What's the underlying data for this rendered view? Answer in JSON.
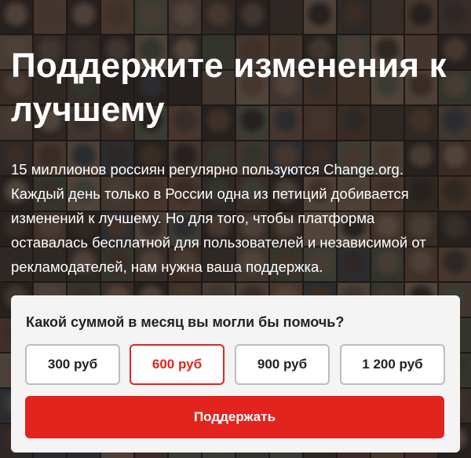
{
  "colors": {
    "accent": "#e3231d",
    "card_background": "#f4f4f4",
    "text_dark": "#222222",
    "text_light": "#ffffff",
    "selected_border": "#e0251f"
  },
  "background": {
    "description_icon": "photo-mosaic-background"
  },
  "hero": {
    "title": "Поддержите изменения к лучшему",
    "description": "15 миллионов россиян регулярно пользуются Change.org. Каждый день только в России одна из петиций добивается изменений к лучшему. Но для того, чтобы платформа оставалась бесплатной для пользователей и независимой от рекламодателей, нам нужна ваша поддержка."
  },
  "donation": {
    "question": "Какой суммой в месяц вы могли бы помочь?",
    "amounts": [
      {
        "label": "300 руб",
        "selected": false
      },
      {
        "label": "600 руб",
        "selected": true
      },
      {
        "label": "900 руб",
        "selected": false
      },
      {
        "label": "1 200 руб",
        "selected": false
      }
    ],
    "submit_label": "Поддержать"
  }
}
